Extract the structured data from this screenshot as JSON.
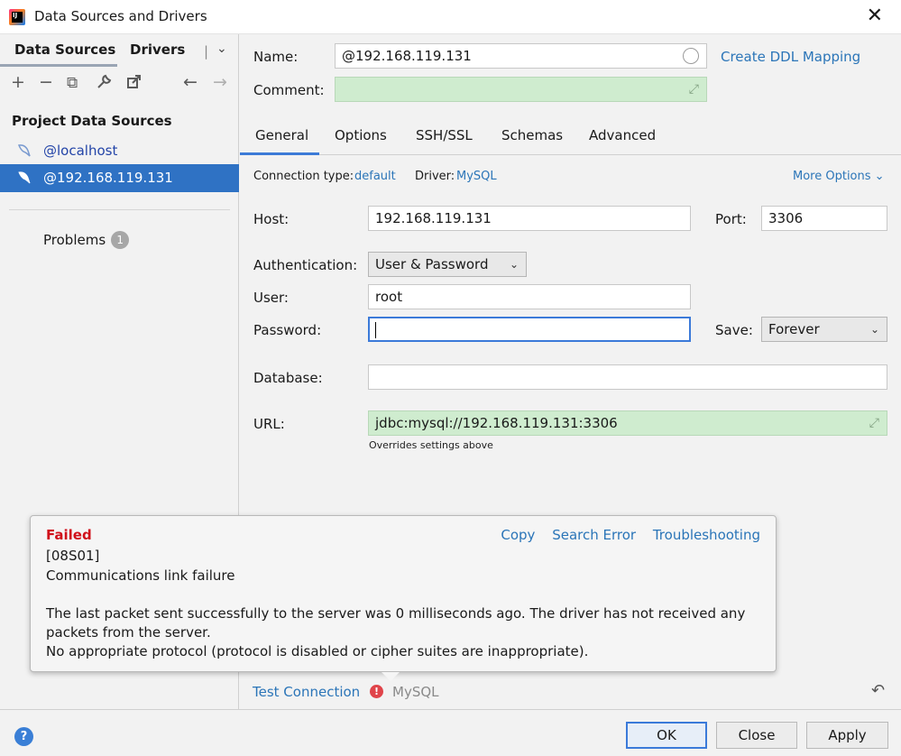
{
  "window": {
    "title": "Data Sources and Drivers",
    "close_glyph": "✕"
  },
  "left": {
    "tabs": {
      "data_sources": "Data Sources",
      "drivers": "Drivers"
    },
    "toolbar": {
      "add": "+",
      "remove": "−",
      "copy": "⧉",
      "wrench": "🔧",
      "export": "⇱",
      "back": "←",
      "forward": "→"
    },
    "section_title": "Project Data Sources",
    "items": [
      {
        "label": "@localhost",
        "icon": "mysql-dolphin-icon"
      },
      {
        "label": "@192.168.119.131",
        "icon": "mysql-dolphin-icon"
      }
    ],
    "problems_label": "Problems",
    "problems_count": "1"
  },
  "form": {
    "name_label": "Name:",
    "name_value": "@192.168.119.131",
    "create_ddl_link": "Create DDL Mapping",
    "comment_label": "Comment:",
    "tabs": [
      "General",
      "Options",
      "SSH/SSL",
      "Schemas",
      "Advanced"
    ],
    "conn_type_label": "Connection type:",
    "conn_type_value": "default",
    "driver_label": "Driver:",
    "driver_value": "MySQL",
    "more_options": "More Options",
    "host_label": "Host:",
    "host_value": "192.168.119.131",
    "port_label": "Port:",
    "port_value": "3306",
    "auth_label": "Authentication:",
    "auth_value": "User & Password",
    "user_label": "User:",
    "user_value": "root",
    "password_label": "Password:",
    "save_label": "Save:",
    "save_value": "Forever",
    "database_label": "Database:",
    "database_value": "",
    "url_label": "URL:",
    "url_value": "jdbc:mysql://192.168.119.131:3306",
    "url_note": "Overrides settings above"
  },
  "error_popup": {
    "status": "Failed",
    "code": "[08S01]",
    "summary": "Communications link failure",
    "detail1": "The last packet sent successfully to the server was 0 milliseconds ago. The driver has not received any",
    "detail2": "packets from the server.",
    "detail3": "No appropriate protocol (protocol is disabled or cipher suites are inappropriate).",
    "links": [
      "Copy",
      "Search Error",
      "Troubleshooting"
    ]
  },
  "test": {
    "label": "Test Connection",
    "driver": "MySQL",
    "error_glyph": "!"
  },
  "buttons": {
    "ok": "OK",
    "close": "Close",
    "apply": "Apply",
    "help": "?"
  },
  "colors": {
    "accent": "#3b7ad9",
    "link": "#2b75b8",
    "error": "#d0101a",
    "selection": "#2f72c4",
    "url_bg": "#cfeccf"
  }
}
